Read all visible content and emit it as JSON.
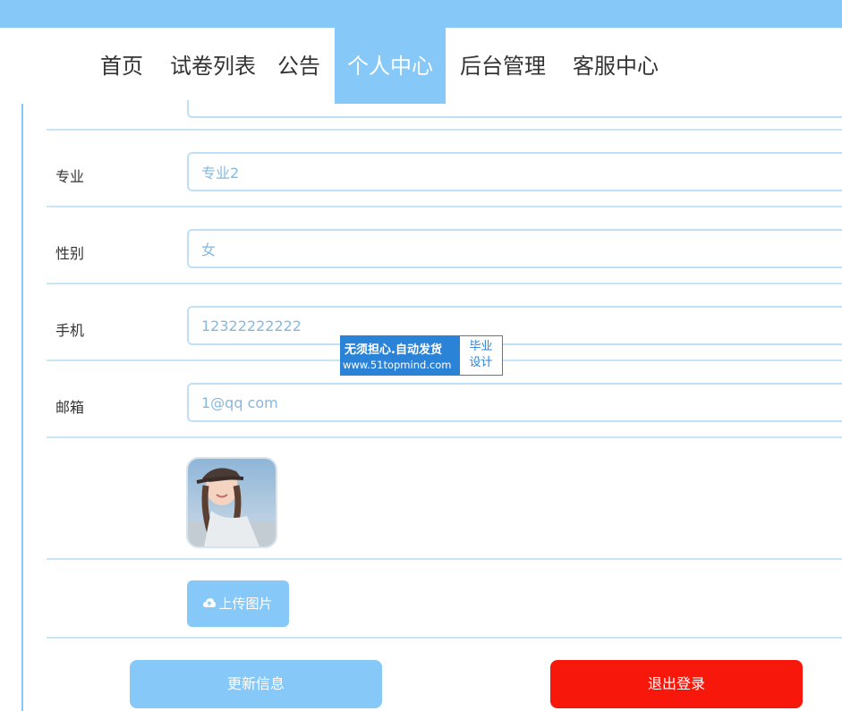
{
  "colors": {
    "accent": "#86c8f7",
    "logout": "#f8170b",
    "watermark": "#2b83d8"
  },
  "nav": {
    "items": [
      "首页",
      "试卷列表",
      "公告",
      "个人中心",
      "后台管理",
      "客服中心"
    ],
    "active": "个人中心"
  },
  "form": {
    "major": {
      "label": "专业",
      "value": "专业2"
    },
    "gender": {
      "label": "性别",
      "value": "女"
    },
    "phone": {
      "label": "手机",
      "value": "12322222222"
    },
    "email": {
      "label": "邮箱",
      "value": "1@qq com"
    }
  },
  "avatar": {
    "icon": "avatar-photo"
  },
  "upload": {
    "icon": "cloud-upload-icon",
    "label": "上传图片"
  },
  "buttons": {
    "update": "更新信息",
    "logout": "退出登录"
  },
  "watermark": {
    "line1": "无须担心.自动发货",
    "line2": "www.51topmind.com",
    "right1": "毕业",
    "right2": "设计"
  }
}
